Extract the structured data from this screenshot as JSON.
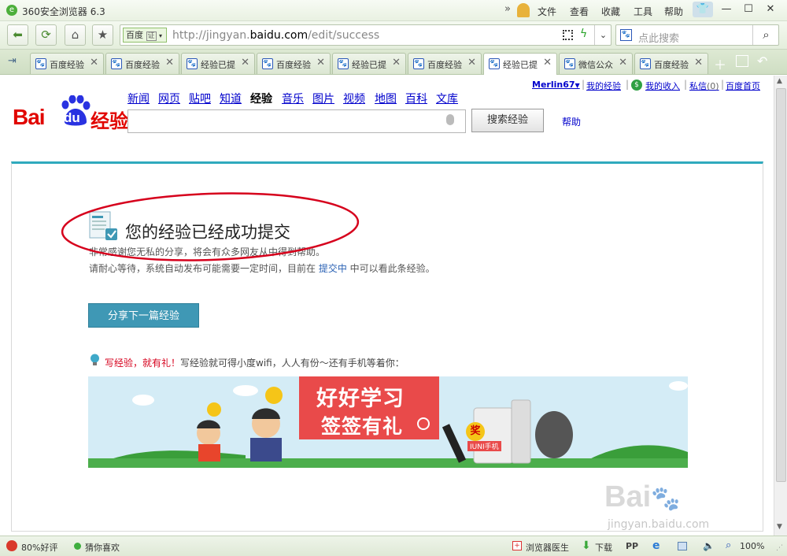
{
  "window": {
    "title": "360安全浏览器 6.3",
    "menu": [
      "文件",
      "查看",
      "收藏",
      "工具",
      "帮助"
    ]
  },
  "addressbar": {
    "site_badge": "百度",
    "verified": "证",
    "url_prefix": "http://jingyan.",
    "url_host": "baidu.com",
    "url_path": "/edit/success",
    "search_placeholder": "点此搜索"
  },
  "tabs": [
    {
      "label": "百度经验"
    },
    {
      "label": "百度经验"
    },
    {
      "label": "经验已提"
    },
    {
      "label": "百度经验"
    },
    {
      "label": "经验已提"
    },
    {
      "label": "百度经验"
    },
    {
      "label": "经验已提"
    },
    {
      "label": "微信公众"
    },
    {
      "label": "百度经验"
    }
  ],
  "page": {
    "logo_bai": "Bai",
    "logo_du": "du",
    "logo_jingyan": "经验",
    "nav": [
      "新闻",
      "网页",
      "贴吧",
      "知道",
      "经验",
      "音乐",
      "图片",
      "视频",
      "地图",
      "百科",
      "文库"
    ],
    "search_button": "搜索经验",
    "help": "帮助",
    "user": {
      "name": "Merlin67",
      "my_exp": "我的经验",
      "my_income": "我的收入",
      "messages": "私信",
      "msg_count": "(0)",
      "home": "百度首页"
    },
    "success_title": "您的经验已经成功提交",
    "thanks_line": "非常感谢您无私的分享，将会有众多网友从中得到帮助。",
    "wait_prefix": "请耐心等待，系统自动发布可能需要一定时间，目前在 ",
    "wait_link": "提交中",
    "wait_suffix": " 中可以看此条经验。",
    "share_button": "分享下一篇经验",
    "promo_red": "写经验，就有礼！",
    "promo_text": "写经验就可得小度wifi，人人有份～还有手机等着你：",
    "banner": {
      "headline1": "好好学习",
      "headline2": "签签有礼",
      "prize": "奖",
      "phone": "IUNI手机"
    },
    "watermark": "jingyan.baidu.com"
  },
  "statusbar": {
    "rating": "80%好评",
    "guess": "猜你喜欢",
    "doctor": "浏览器医生",
    "download": "下载",
    "zoom": "100%"
  },
  "colors": {
    "accent": "#2faabd",
    "baidu_red": "#e10601",
    "baidu_blue": "#2932e1",
    "button": "#3f98b5",
    "annotation": "#d6001c"
  }
}
